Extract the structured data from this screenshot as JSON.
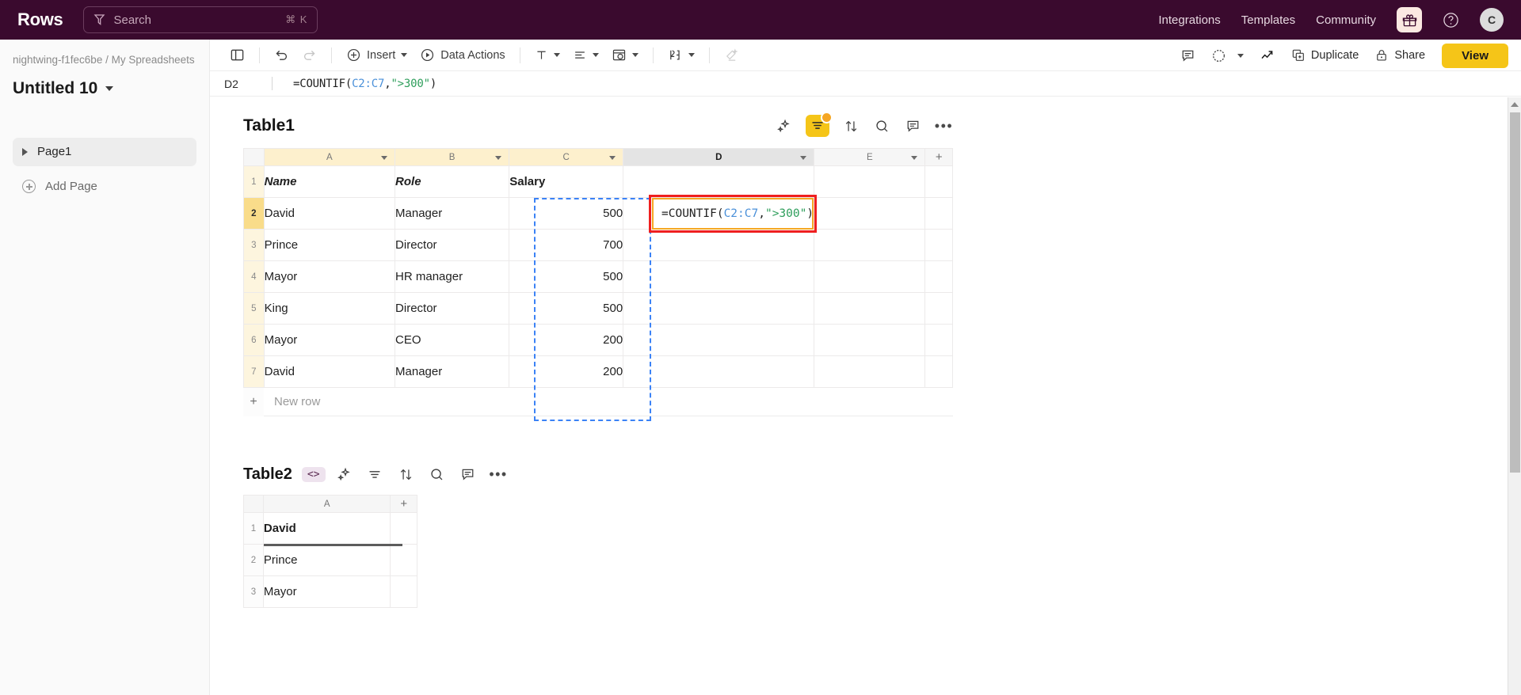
{
  "topbar": {
    "brand": "Rows",
    "search": {
      "placeholder": "Search",
      "shortcut": "⌘ K",
      "icon": "filter-search-icon"
    },
    "nav": [
      {
        "label": "Integrations"
      },
      {
        "label": "Templates"
      },
      {
        "label": "Community"
      }
    ],
    "gift_icon": "gift-icon",
    "help_icon": "help-circle-icon",
    "avatar_initial": "C",
    "bg_color": "#3a0a2e"
  },
  "sidebar": {
    "breadcrumb": "nightwing-f1fec6be / My Spreadsheets",
    "doc_title": "Untitled 10",
    "pages": [
      {
        "label": "Page1"
      }
    ],
    "add_page_label": "Add Page"
  },
  "toolbar": {
    "panel_icon": "sidebar-toggle-icon",
    "undo_icon": "undo-icon",
    "redo_icon": "redo-icon",
    "insert_label": "Insert",
    "data_actions_label": "Data Actions",
    "text_format_icon": "text-format-icon",
    "align_icon": "align-left-icon",
    "cell_style_icon": "cell-color-icon",
    "number_format_icon": "number-format-icon",
    "clear_format_icon": "clear-format-icon",
    "comment_icon": "comment-icon",
    "history_icon": "history-clock-icon",
    "trend_icon": "trend-up-icon",
    "duplicate_label": "Duplicate",
    "share_label": "Share",
    "view_label": "View",
    "accent_color": "#f5c518"
  },
  "formula_bar": {
    "cell_ref": "D2",
    "formula_prefix": "=COUNTIF(",
    "formula_ref": "C2:C7",
    "formula_comma": ",",
    "formula_string": "\">300\"",
    "formula_suffix": ")"
  },
  "table1": {
    "name": "Table1",
    "tools": [
      "ai-sparkle-icon",
      "filter-icon",
      "sort-icon",
      "search-icon",
      "comment-icon",
      "more-options-icon"
    ],
    "filter_active": true,
    "columns": [
      {
        "letter": "A",
        "state": "filtered"
      },
      {
        "letter": "B",
        "state": "filtered"
      },
      {
        "letter": "C",
        "state": "filtered"
      },
      {
        "letter": "D",
        "state": "selected"
      },
      {
        "letter": "E",
        "state": "normal"
      }
    ],
    "add_column_label": "+",
    "rows": [
      {
        "num": "1",
        "state": "filtered",
        "cells": [
          "Name",
          "Role",
          "Salary",
          "",
          ""
        ]
      },
      {
        "num": "2",
        "state": "current",
        "cells": [
          "David",
          "Manager",
          "500",
          "",
          ""
        ]
      },
      {
        "num": "3",
        "state": "filtered",
        "cells": [
          "Prince",
          "Director",
          "700",
          "",
          ""
        ]
      },
      {
        "num": "4",
        "state": "filtered",
        "cells": [
          "Mayor",
          "HR manager",
          "500",
          "",
          ""
        ]
      },
      {
        "num": "5",
        "state": "filtered",
        "cells": [
          "King",
          "Director",
          "500",
          "",
          ""
        ]
      },
      {
        "num": "6",
        "state": "filtered",
        "cells": [
          "Mayor",
          "CEO",
          "200",
          "",
          ""
        ]
      },
      {
        "num": "7",
        "state": "filtered",
        "cells": [
          "David",
          "Manager",
          "200",
          "",
          ""
        ]
      }
    ],
    "new_row_label": "New row",
    "editing_cell": {
      "prefix": "=COUNTIF(",
      "ref": "C2:C7",
      "comma": ",",
      "string": "\">300\"",
      "suffix": ")"
    },
    "selection_range": "C2:C7",
    "highlight_color": "#ef1f1f"
  },
  "table2": {
    "name": "Table2",
    "code_badge": "<>",
    "tools": [
      "ai-sparkle-icon",
      "filter-icon",
      "sort-icon",
      "search-icon",
      "comment-icon",
      "more-options-icon"
    ],
    "columns": [
      {
        "letter": "A"
      }
    ],
    "add_column_label": "+",
    "rows": [
      {
        "num": "1",
        "cells": [
          "David"
        ],
        "bold": true
      },
      {
        "num": "2",
        "cells": [
          "Prince"
        ],
        "bold": false
      },
      {
        "num": "3",
        "cells": [
          "Mayor"
        ],
        "bold": false
      }
    ]
  }
}
